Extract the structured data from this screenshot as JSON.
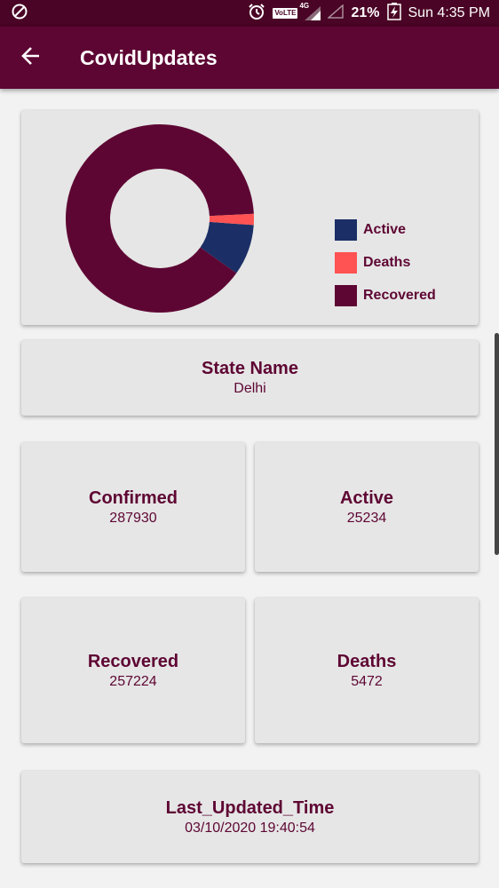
{
  "status_bar": {
    "network_label": "VoLTE",
    "lte_label": "4G",
    "battery": "21%",
    "time": "Sun 4:35 PM"
  },
  "app_bar": {
    "title": "CovidUpdates"
  },
  "chart_data": {
    "type": "pie",
    "categories": [
      "Active",
      "Deaths",
      "Recovered"
    ],
    "values": [
      25234,
      5472,
      257224
    ],
    "colors": [
      "#1b2f66",
      "#ff5252",
      "#5e0633"
    ],
    "legend_position": "right",
    "donut": true
  },
  "state": {
    "label": "State Name",
    "value": "Delhi"
  },
  "stats": {
    "confirmed": {
      "label": "Confirmed",
      "value": "287930"
    },
    "active": {
      "label": "Active",
      "value": "25234"
    },
    "recovered": {
      "label": "Recovered",
      "value": "257224"
    },
    "deaths": {
      "label": "Deaths",
      "value": "5472"
    }
  },
  "last_updated": {
    "label": "Last_Updated_Time",
    "value": "03/10/2020 19:40:54"
  },
  "colors": {
    "primary": "#5e0633",
    "primary_dark": "#4a0425",
    "active": "#1b2f66",
    "deaths": "#ff5252",
    "card": "#e6e6e6",
    "background": "#f2f2f2"
  }
}
